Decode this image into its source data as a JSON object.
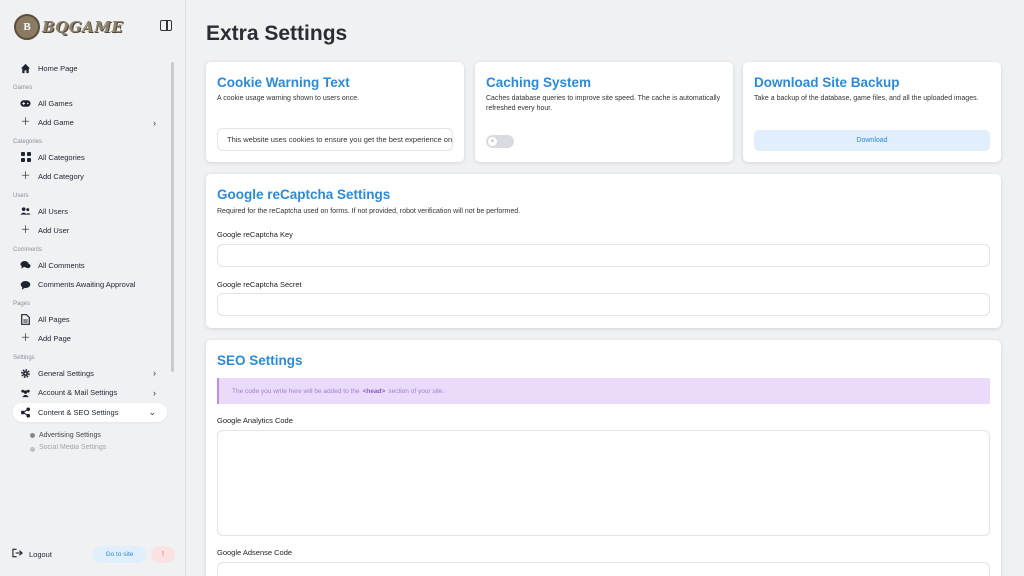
{
  "brand": {
    "logo_text": "BQGAME",
    "badge_text": "B"
  },
  "sidebar": {
    "home": "Home Page",
    "sections": {
      "games": "Games",
      "categories": "Categories",
      "users": "Users",
      "comments": "Comments",
      "pages": "Pages",
      "settings": "Settings"
    },
    "items": {
      "all_games": "All Games",
      "add_game": "Add Game",
      "all_categories": "All Categories",
      "add_category": "Add Category",
      "all_users": "All Users",
      "add_user": "Add User",
      "all_comments": "All Comments",
      "comments_awaiting": "Comments Awaiting Approval",
      "all_pages": "All Pages",
      "add_page": "Add Page",
      "general_settings": "General Settings",
      "account_mail_settings": "Account & Mail Settings",
      "content_seo_settings": "Content & SEO Settings",
      "advertising_settings": "Advertising Settings",
      "social_media_settings": "Social Media Settings"
    },
    "logout": "Logout",
    "go_to_site": "Go to site",
    "alert": "!"
  },
  "page": {
    "title": "Extra Settings"
  },
  "cookie": {
    "title": "Cookie Warning Text",
    "desc": "A cookie usage warning shown to users once.",
    "value": "This website uses cookies to ensure you get the best experience on our website."
  },
  "caching": {
    "title": "Caching System",
    "desc": "Caches database queries to improve site speed. The cache is automatically refreshed every hour.",
    "enabled": false
  },
  "backup": {
    "title": "Download Site Backup",
    "desc": "Take a backup of the database, game files, and all the uploaded images.",
    "button": "Download"
  },
  "recaptcha": {
    "title": "Google reCaptcha Settings",
    "desc": "Required for the reCaptcha used on forms. If not provided, robot verification will not be performed.",
    "key_label": "Google reCaptcha Key",
    "key_value": "",
    "secret_label": "Google reCaptcha Secret",
    "secret_value": ""
  },
  "seo": {
    "title": "SEO Settings",
    "notice_prefix": "The code you write here will be added to the",
    "notice_tag": "<head>",
    "notice_suffix": "section of your site.",
    "analytics_label": "Google Analytics Code",
    "analytics_value": "",
    "adsense_label": "Google Adsense Code",
    "adsense_value": ""
  }
}
